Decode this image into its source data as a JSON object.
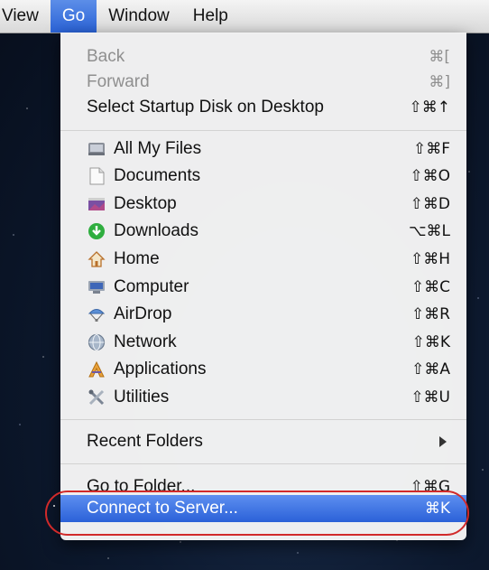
{
  "menubar": {
    "items": [
      {
        "label": "View"
      },
      {
        "label": "Go"
      },
      {
        "label": "Window"
      },
      {
        "label": "Help"
      }
    ]
  },
  "go_menu": {
    "back": {
      "label": "Back",
      "shortcut": "⌘["
    },
    "forward": {
      "label": "Forward",
      "shortcut": "⌘]"
    },
    "startup_disk": {
      "label": "Select Startup Disk on Desktop",
      "shortcut": "⇧⌘↑"
    },
    "places": [
      {
        "label": "All My Files",
        "shortcut": "⇧⌘F",
        "icon": "all-my-files-icon"
      },
      {
        "label": "Documents",
        "shortcut": "⇧⌘O",
        "icon": "documents-icon"
      },
      {
        "label": "Desktop",
        "shortcut": "⇧⌘D",
        "icon": "desktop-icon"
      },
      {
        "label": "Downloads",
        "shortcut": "⌥⌘L",
        "icon": "downloads-icon"
      },
      {
        "label": "Home",
        "shortcut": "⇧⌘H",
        "icon": "home-icon"
      },
      {
        "label": "Computer",
        "shortcut": "⇧⌘C",
        "icon": "computer-icon"
      },
      {
        "label": "AirDrop",
        "shortcut": "⇧⌘R",
        "icon": "airdrop-icon"
      },
      {
        "label": "Network",
        "shortcut": "⇧⌘K",
        "icon": "network-icon"
      },
      {
        "label": "Applications",
        "shortcut": "⇧⌘A",
        "icon": "applications-icon"
      },
      {
        "label": "Utilities",
        "shortcut": "⇧⌘U",
        "icon": "utilities-icon"
      }
    ],
    "recent_folders": {
      "label": "Recent Folders"
    },
    "go_to_folder": {
      "label": "Go to Folder...",
      "shortcut": "⇧⌘G"
    },
    "connect_to_server": {
      "label": "Connect to Server...",
      "shortcut": "⌘K"
    }
  },
  "colors": {
    "highlight": "#2b61d8",
    "callout": "#d12a2a",
    "disabled_text": "#8f8f8f"
  }
}
